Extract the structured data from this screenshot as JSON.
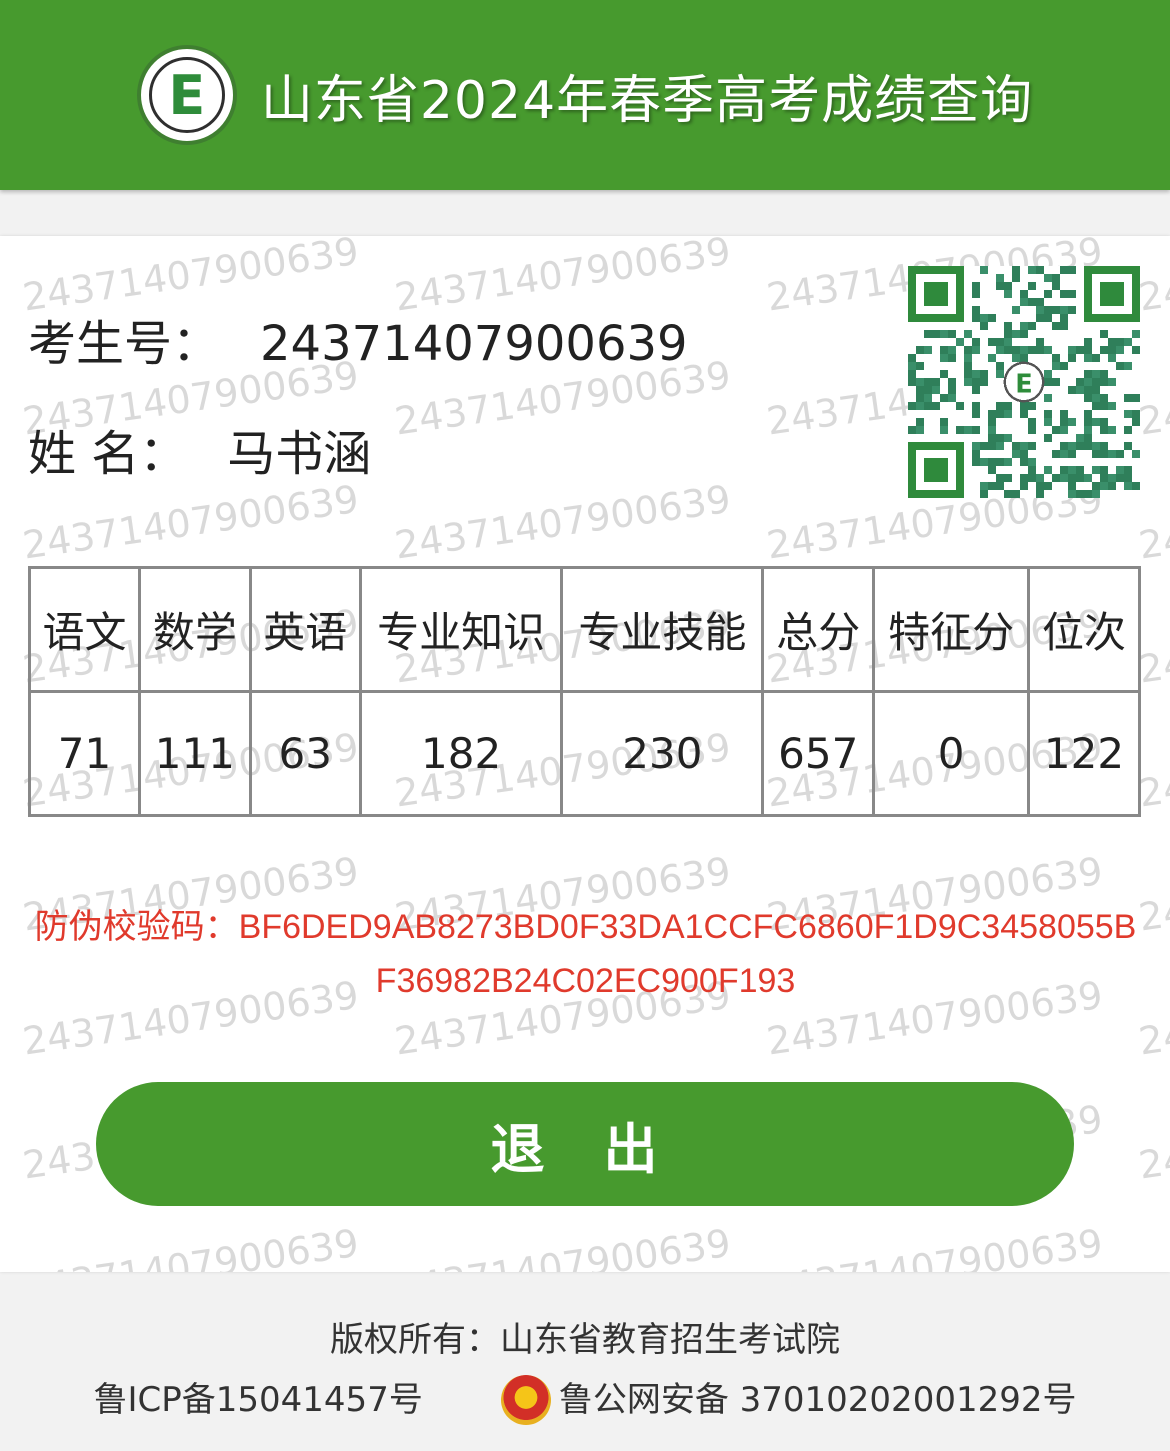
{
  "header": {
    "logo_icon": "e-logo-icon",
    "logo_letter": "E",
    "title": "山东省2024年春季高考成绩查询"
  },
  "watermark_text": "24371407900639",
  "student": {
    "id_label": "考生号：",
    "id_value": "24371407900639",
    "name_label": "姓 名：",
    "name_value": "马书涵"
  },
  "qr_icon": "qr-code-icon",
  "scores": {
    "headers": [
      "语文",
      "数学",
      "英语",
      "专业知识",
      "专业技能",
      "总分",
      "特征分",
      "位次"
    ],
    "values": [
      "71",
      "111",
      "63",
      "182",
      "230",
      "657",
      "0",
      "122"
    ]
  },
  "verify": {
    "label": "防伪校验码：",
    "code": "BF6DED9AB8273BD0F33DA1CCFC6860F1D9C3458055BF36982B24C02EC900F193"
  },
  "logout_label": "退 出",
  "footer": {
    "copyright": "版权所有：山东省教育招生考试院",
    "icp": "鲁ICP备15041457号",
    "police_icon": "police-badge-icon",
    "security": "鲁公网安备 37010202001292号"
  },
  "colors": {
    "brand_green": "#479a2e",
    "verify_red": "#e03a2c",
    "watermark_gray": "#d9d9d9"
  }
}
